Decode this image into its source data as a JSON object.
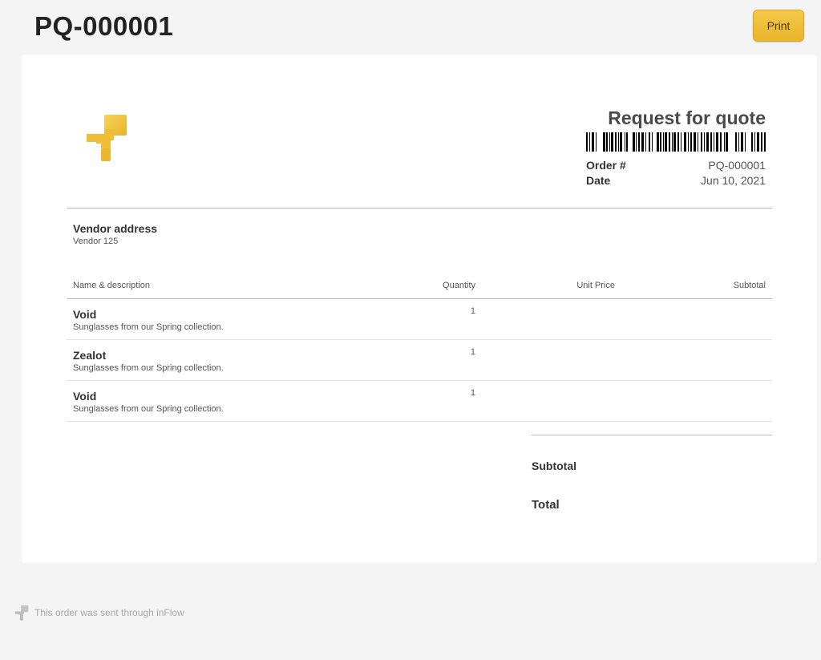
{
  "header": {
    "title": "PQ-000001",
    "print_label": "Print"
  },
  "document": {
    "title": "Request for quote",
    "meta": [
      {
        "label": "Order #",
        "value": "PQ-000001"
      },
      {
        "label": "Date",
        "value": "Jun 10, 2021"
      }
    ],
    "vendor": {
      "heading": "Vendor address",
      "name": "Vendor 125"
    },
    "table": {
      "columns": {
        "name": "Name & description",
        "quantity": "Quantity",
        "unit_price": "Unit Price",
        "subtotal": "Subtotal"
      },
      "rows": [
        {
          "name": "Void",
          "description": "Sunglasses from our Spring collection.",
          "quantity": "1"
        },
        {
          "name": "Zealot",
          "description": "Sunglasses from our Spring collection.",
          "quantity": "1"
        },
        {
          "name": "Void",
          "description": "Sunglasses from our Spring collection.",
          "quantity": "1"
        }
      ]
    },
    "totals": {
      "subtotal_label": "Subtotal",
      "total_label": "Total"
    }
  },
  "footer": {
    "text": "This order was sent through inFlow"
  },
  "colors": {
    "accent": "#f0bf3a",
    "background": "#f4f4f4",
    "card": "#ffffff"
  }
}
